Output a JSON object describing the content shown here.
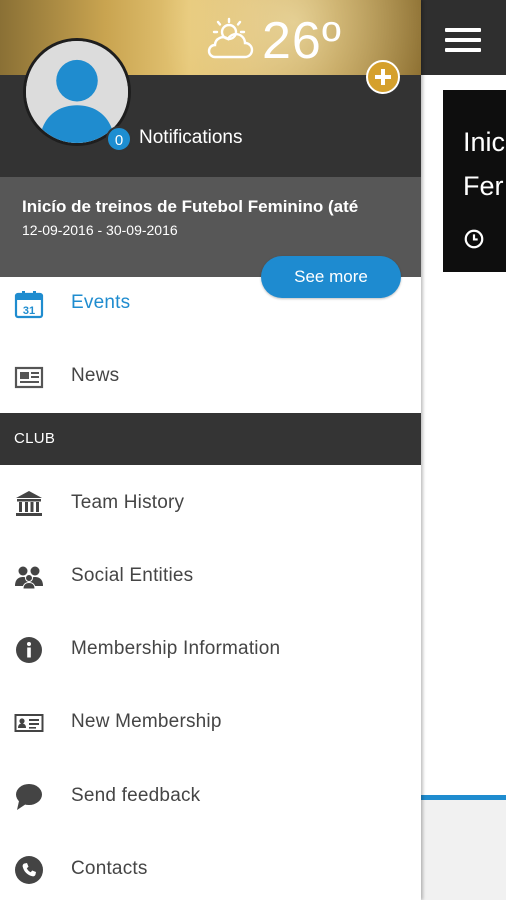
{
  "weather": {
    "icon": "partly-cloudy-icon",
    "temperature": "26º"
  },
  "profile": {
    "notification_count": "0",
    "notifications_label": "Notifications"
  },
  "featured_event": {
    "title": "Inicío de treinos de Futebol Feminino (até",
    "dates": "12-09-2016 - 30-09-2016",
    "see_more_label": "See more"
  },
  "menu": [
    {
      "label": "Events",
      "icon": "calendar-icon",
      "active": true
    },
    {
      "label": "News",
      "icon": "newspaper-icon",
      "active": false
    }
  ],
  "club_section": {
    "header": "CLUB",
    "items": [
      {
        "label": "Team History",
        "icon": "museum-icon"
      },
      {
        "label": "Social Entities",
        "icon": "group-icon"
      },
      {
        "label": "Membership Information",
        "icon": "info-icon"
      },
      {
        "label": "New Membership",
        "icon": "id-card-icon"
      },
      {
        "label": "Send feedback",
        "icon": "chat-bubble-icon"
      },
      {
        "label": "Contacts",
        "icon": "phone-icon"
      }
    ]
  },
  "background_screen": {
    "card_title_partial": "Inic\nFer"
  },
  "colors": {
    "accent": "#1f8ccf",
    "gold": "#d5a02c",
    "dark": "#333333",
    "event_band": "#575757"
  }
}
